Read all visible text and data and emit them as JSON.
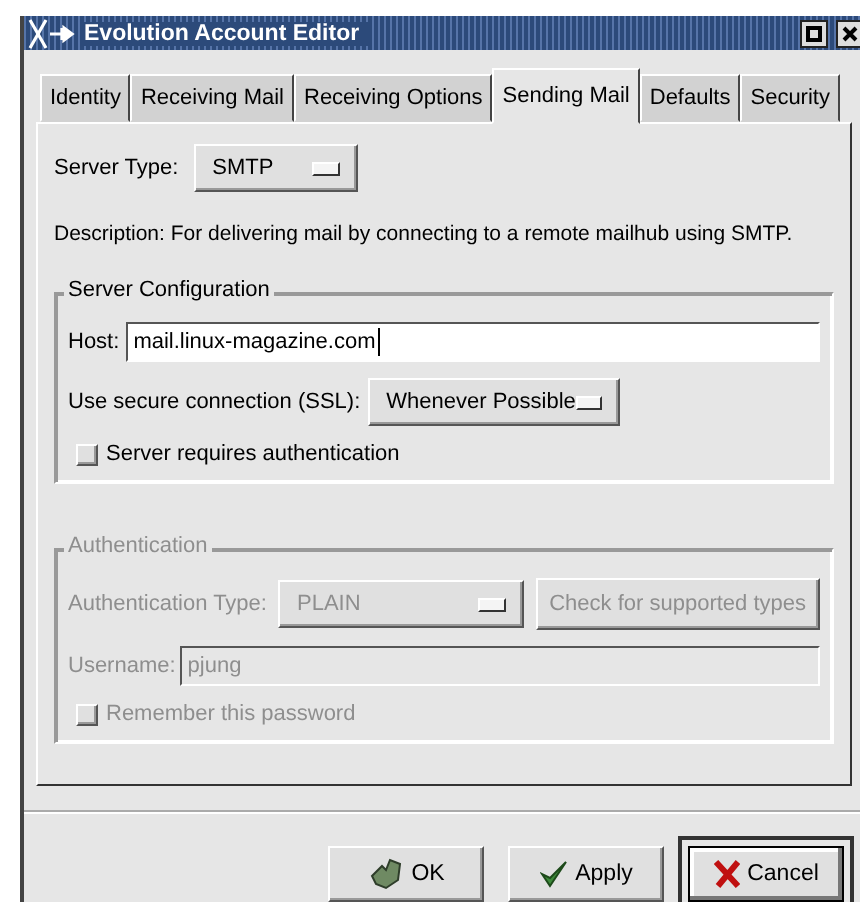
{
  "window": {
    "title": "Evolution Account Editor"
  },
  "tabs": [
    {
      "label": "Identity",
      "selected": false
    },
    {
      "label": "Receiving Mail",
      "selected": false
    },
    {
      "label": "Receiving Options",
      "selected": false
    },
    {
      "label": "Sending Mail",
      "selected": true
    },
    {
      "label": "Defaults",
      "selected": false
    },
    {
      "label": "Security",
      "selected": false
    }
  ],
  "server_type": {
    "label": "Server Type:",
    "value": "SMTP"
  },
  "description": "Description: For delivering mail by connecting to a remote mailhub using SMTP.",
  "server_configuration": {
    "title": "Server Configuration",
    "host": {
      "label": "Host:",
      "value": "mail.linux-magazine.com"
    },
    "ssl": {
      "label": "Use secure connection (SSL):",
      "value": "Whenever Possible"
    },
    "auth_required": {
      "label": "Server requires authentication",
      "checked": false
    }
  },
  "authentication": {
    "title": "Authentication",
    "disabled": true,
    "auth_type": {
      "label": "Authentication Type:",
      "value": "PLAIN"
    },
    "check_button": "Check for supported types",
    "username": {
      "label": "Username:",
      "value": "pjung"
    },
    "remember": {
      "label": "Remember this password",
      "checked": false
    }
  },
  "buttons": [
    {
      "label": "OK",
      "kind": "ok",
      "default": false
    },
    {
      "label": "Apply",
      "kind": "apply",
      "default": false
    },
    {
      "label": "Cancel",
      "kind": "cancel",
      "default": true
    }
  ]
}
